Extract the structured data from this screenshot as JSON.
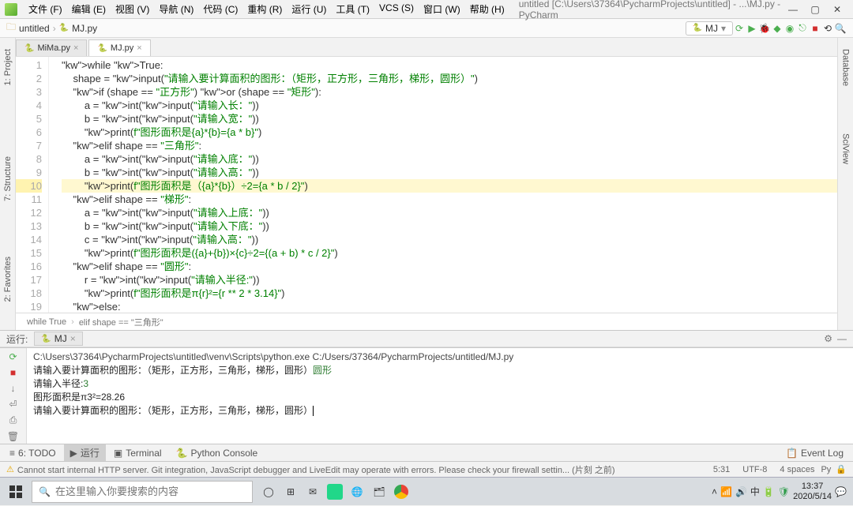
{
  "window": {
    "title": "untitled [C:\\Users\\37364\\PycharmProjects\\untitled] - ...\\MJ.py - PyCharm"
  },
  "menu": [
    "文件 (F)",
    "编辑 (E)",
    "视图 (V)",
    "导航 (N)",
    "代码 (C)",
    "重构 (R)",
    "运行 (U)",
    "工具 (T)",
    "VCS (S)",
    "窗口 (W)",
    "帮助 (H)"
  ],
  "breadcrumb": {
    "root": "untitled",
    "file": "MJ.py"
  },
  "runconfig": {
    "name": "MJ"
  },
  "tabs": [
    {
      "label": "MiMa.py",
      "active": false
    },
    {
      "label": "MJ.py",
      "active": true
    }
  ],
  "side": {
    "left1": "1: Project",
    "left2": "7: Structure",
    "left3": "2: Favorites",
    "right1": "Database",
    "right2": "SciView"
  },
  "code_crumb": {
    "a": "while True",
    "b": "elif shape == \"三角形\""
  },
  "lines": [
    1,
    2,
    3,
    4,
    5,
    6,
    7,
    8,
    9,
    10,
    11,
    12,
    13,
    14,
    15,
    16,
    17,
    18,
    19
  ],
  "code": {
    "l1": "while True:",
    "l2": "    shape = input(\"请输入要计算面积的图形：（矩形，正方形，三角形，梯形，圆形）\")",
    "l3": "    if (shape == \"正方形\") or (shape == \"矩形\"):",
    "l4": "        a = int(input(\"请输入长：\"))",
    "l5": "        b = int(input(\"请输入宽：\"))",
    "l6": "        print(f\"图形面积是{a}*{b}={a * b}\")",
    "l7": "    elif shape == \"三角形\":",
    "l8": "        a = int(input(\"请输入底：\"))",
    "l9": "        b = int(input(\"请输入高：\"))",
    "l10": "        print(f\"图形面积是（{a}*{b}）÷2={a * b / 2}\")",
    "l11": "    elif shape == \"梯形\":",
    "l12": "        a = int(input(\"请输入上底：\"))",
    "l13": "        b = int(input(\"请输入下底：\"))",
    "l14": "        c = int(input(\"请输入高：\"))",
    "l15": "        print(f\"图形面积是({a}+{b})×{c}÷2={(a + b) * c / 2}\")",
    "l16": "    elif shape == \"圆形\":",
    "l17": "        r = int(input(\"请输入半径:\"))",
    "l18": "        print(f\"图形面积是π{r}²={r ** 2 * 3.14}\")",
    "l19": "    else:"
  },
  "run": {
    "label": "运行:",
    "tab": "MJ",
    "out_cmd": "C:\\Users\\37364\\PycharmProjects\\untitled\\venv\\Scripts\\python.exe C:/Users/37364/PycharmProjects/untitled/MJ.py",
    "out_prompt1": "请输入要计算面积的图形：（矩形，正方形，三角形，梯形，圆形）",
    "out_in1": "圆形",
    "out_prompt2": "请输入半径:",
    "out_in2": "3",
    "out_res": "图形面积是π3²=28.26",
    "out_prompt3": "请输入要计算面积的图形：（矩形，正方形，三角形，梯形，圆形）"
  },
  "bottom": {
    "todo": "6: TODO",
    "run": "运行",
    "terminal": "Terminal",
    "pyconsole": "Python Console",
    "eventlog": "Event Log"
  },
  "status": {
    "msg": "Cannot start internal HTTP server. Git integration, JavaScript debugger and LiveEdit may operate with errors. Please check your firewall settin... (片刻 之前)",
    "pos": "5:31",
    "enc": "UTF-8",
    "spaces": "4 spaces"
  },
  "taskbar": {
    "search_placeholder": "在这里输入你要搜索的内容",
    "time": "13:37",
    "date": "2020/5/14"
  }
}
